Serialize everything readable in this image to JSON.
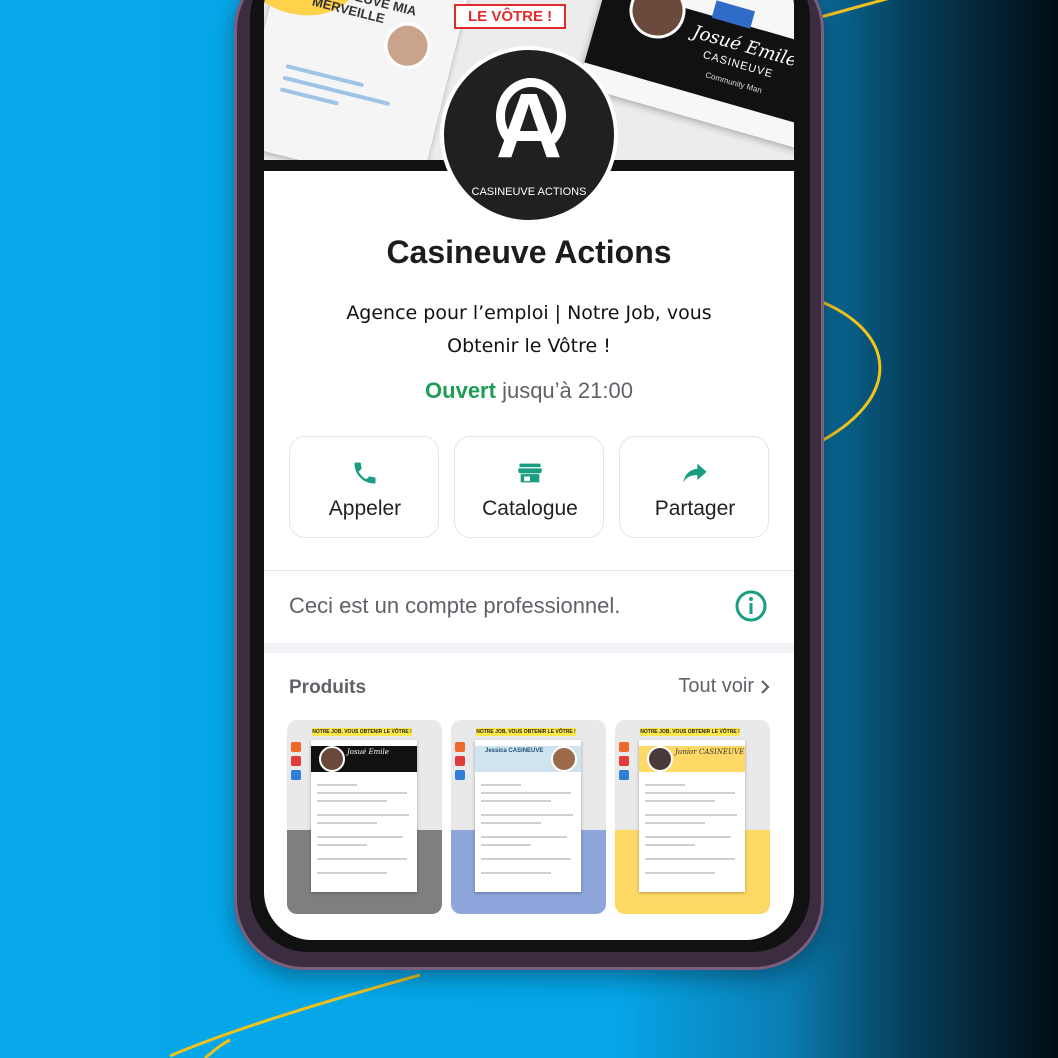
{
  "colors": {
    "accent_green": "#1f9d55",
    "icon_green": "#1a9e82",
    "text_gray": "#5f6368",
    "background_blue": "#06a8ea",
    "deco_yellow": "#f2c21b"
  },
  "cover": {
    "tag": "LE VÔTRE !",
    "left_card_name": "CASINEUVE MIA MERVEILLE",
    "right_card_name": "Josué Emile",
    "right_card_surname": "CASINEUVE",
    "right_card_role": "Community Man"
  },
  "logo": {
    "text": "CASINEUVE ACTIONS",
    "letter": "A"
  },
  "business": {
    "name": "Casineuve Actions",
    "description": "Agence pour l’emploi | Notre Job, vous Obtenir le Vôtre !",
    "hours_status": "Ouvert",
    "hours_until": "jusqu’à 21:00"
  },
  "actions": [
    {
      "label": "Appeler",
      "icon": "phone-icon"
    },
    {
      "label": "Catalogue",
      "icon": "store-icon"
    },
    {
      "label": "Partager",
      "icon": "share-icon"
    }
  ],
  "info": {
    "text": "Ceci est un compte professionnel.",
    "icon": "info-icon"
  },
  "products": {
    "title": "Produits",
    "see_all": "Tout voir",
    "items": [
      {
        "tag": "NOTRE JOB, VOUS OBTENIR LE VÔTRE !",
        "name": "Josué Emile",
        "band_color": "#7f7f7f",
        "header_color": "#111111"
      },
      {
        "tag": "NOTRE JOB, VOUS OBTENIR LE VÔTRE !",
        "name": "Jessica CASINEUVE",
        "band_color": "#8ea6dc",
        "header_color": "#cfe4ee"
      },
      {
        "tag": "NOTRE JOB, VOUS OBTENIR LE VÔTRE !",
        "name": "Junior CASINEUVE",
        "band_color": "#ffd966",
        "header_color": "#ffd966"
      }
    ]
  }
}
